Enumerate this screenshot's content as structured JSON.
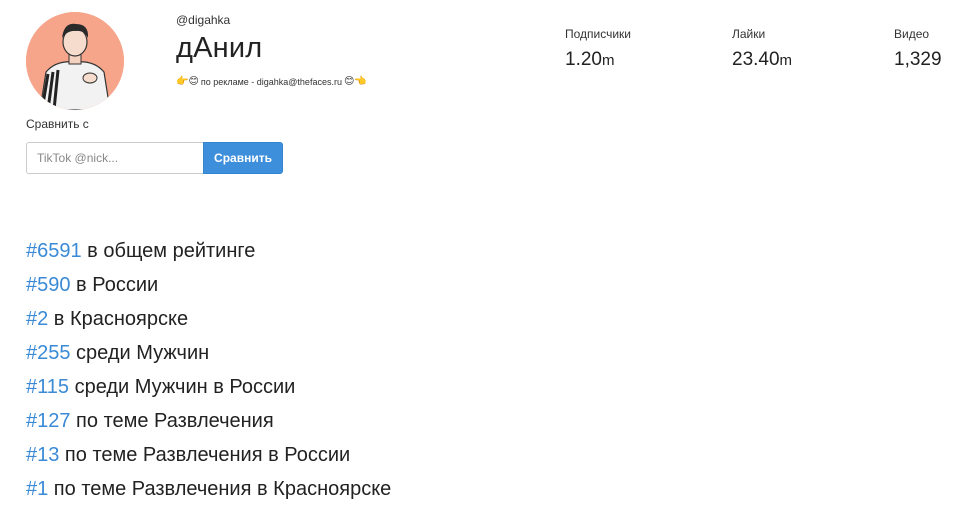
{
  "profile": {
    "handle": "@digahka",
    "name": "дАнил",
    "bio": "по рекламе - digahka@thefaces.ru",
    "bio_emoji_left": "👉😊",
    "bio_emoji_right": "😊👈"
  },
  "stats": [
    {
      "label": "Подписчики",
      "value": "1.20",
      "unit": "m"
    },
    {
      "label": "Лайки",
      "value": "23.40",
      "unit": "m"
    },
    {
      "label": "Видео",
      "value": "1,329",
      "unit": ""
    }
  ],
  "compare": {
    "label": "Сравнить с",
    "placeholder": "TikTok @nick...",
    "button": "Сравнить"
  },
  "ranks": [
    {
      "num": "#6591",
      "text": " в общем рейтинге"
    },
    {
      "num": "#590",
      "text": " в России"
    },
    {
      "num": "#2",
      "text": " в Красноярске"
    },
    {
      "num": "#255",
      "text": " среди Мужчин"
    },
    {
      "num": "#115",
      "text": " среди Мужчин в России"
    },
    {
      "num": "#127",
      "text": " по теме Развлечения"
    },
    {
      "num": "#13",
      "text": " по теме Развлечения в России"
    },
    {
      "num": "#1",
      "text": " по теме Развлечения в Красноярске"
    }
  ],
  "colors": {
    "accent": "#3a8ad6",
    "button": "#3d8fdb",
    "avatar_bg": "#f7a58a"
  }
}
